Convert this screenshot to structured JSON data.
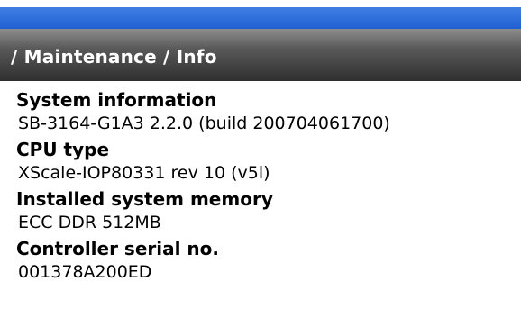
{
  "header": {
    "breadcrumb": "/ Maintenance / Info"
  },
  "info": [
    {
      "label": "System information",
      "value": "SB-3164-G1A3 2.2.0 (build 200704061700)"
    },
    {
      "label": "CPU type",
      "value": "XScale-IOP80331 rev 10 (v5l)"
    },
    {
      "label": "Installed system memory",
      "value": "ECC DDR 512MB"
    },
    {
      "label": "Controller serial no.",
      "value": "001378A200ED"
    }
  ],
  "colors": {
    "blue_bar": "#2a6ad9",
    "title_bar": "#3a3a3a",
    "title_text": "#ffffff"
  }
}
